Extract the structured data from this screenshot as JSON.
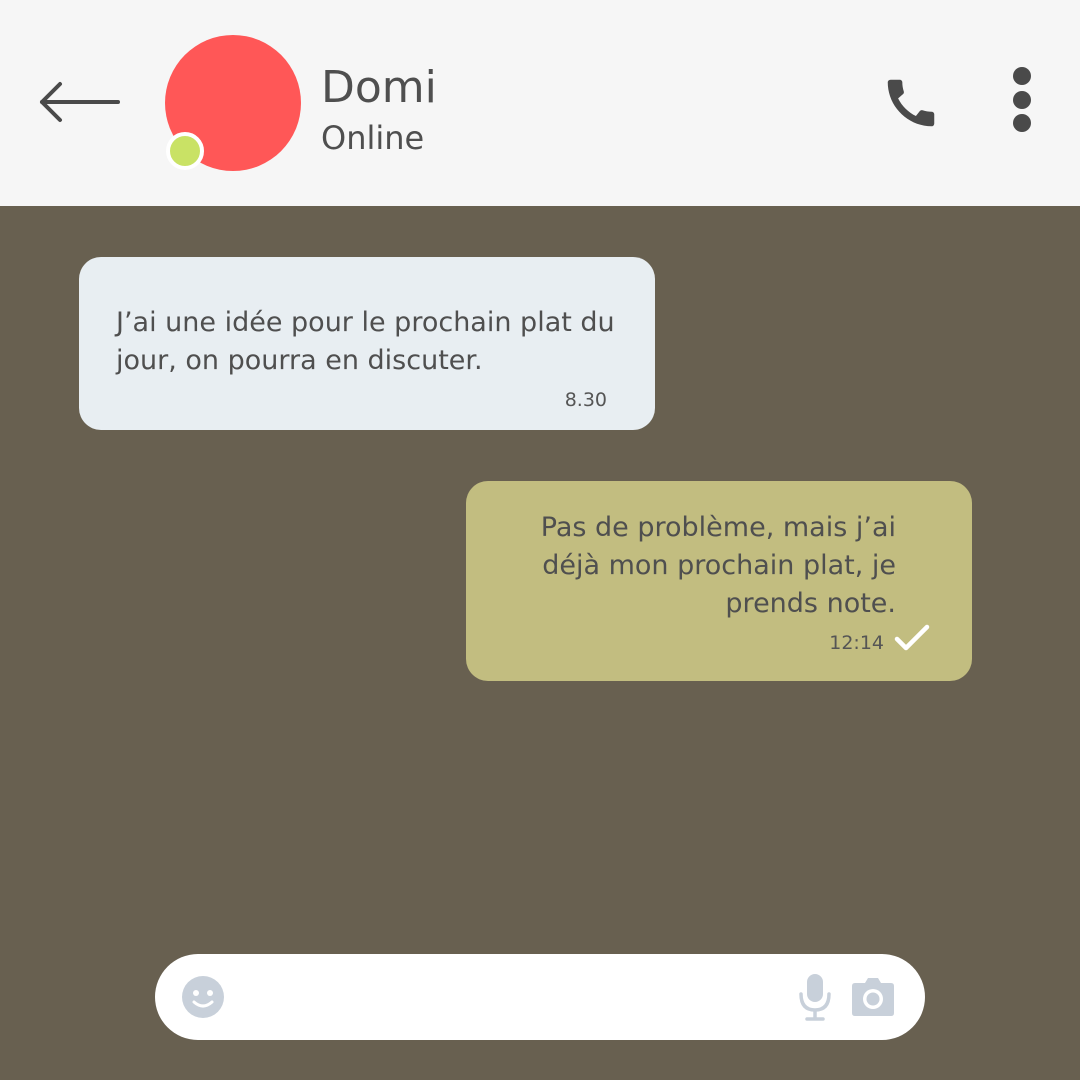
{
  "header": {
    "contact_name": "Domi",
    "contact_status": "Online",
    "back_icon": "arrow-left-icon",
    "call_icon": "phone-icon",
    "more_icon": "more-vertical-icon"
  },
  "messages": [
    {
      "direction": "incoming",
      "text": "J’ai une idée pour le prochain plat du jour, on pourra en discuter.",
      "time": "8.30"
    },
    {
      "direction": "outgoing",
      "text": "Pas de problème, mais j’ai déjà mon prochain plat, je prends note.",
      "time": "12:14",
      "status_icon": "check-icon"
    }
  ],
  "composer": {
    "placeholder": "",
    "value": "",
    "emoji_icon": "emoji-icon",
    "mic_icon": "microphone-icon",
    "camera_icon": "camera-icon"
  },
  "colors": {
    "chat_background": "#686050",
    "header_background": "#f6f6f6",
    "avatar": "#ff5757",
    "online_dot": "#c9e265",
    "incoming_bubble": "#e8eef2",
    "outgoing_bubble": "#c2bd80",
    "text": "#4f4f4f",
    "icon_dark": "#4a4a4a",
    "composer_icon": "#c8d0da"
  }
}
